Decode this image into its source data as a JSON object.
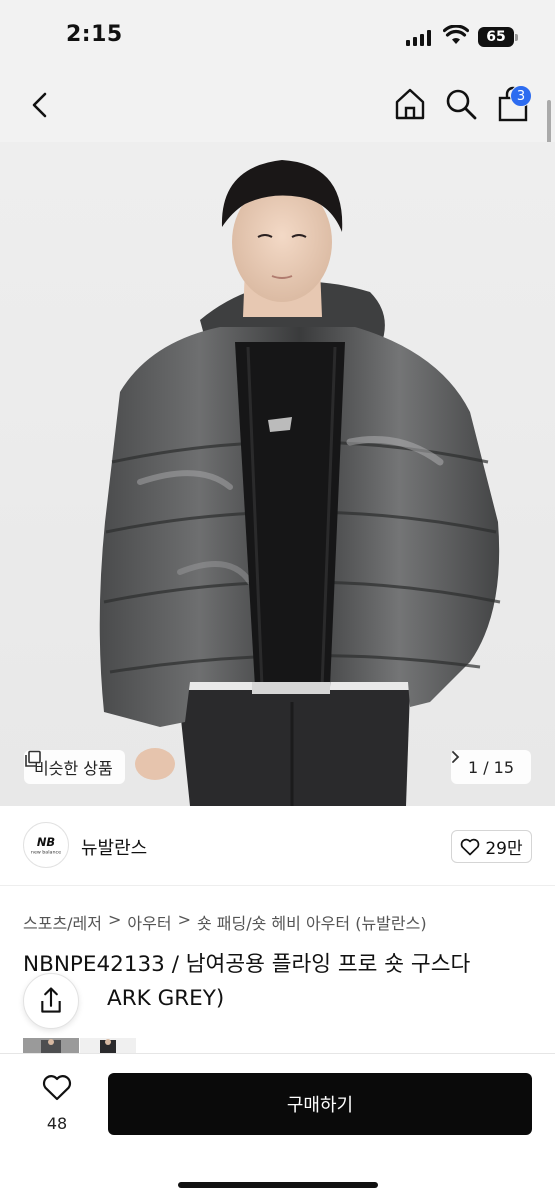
{
  "status_bar": {
    "time": "2:15",
    "battery": "65"
  },
  "nav": {
    "back_icon": "chevron-left-icon",
    "home_icon": "home-icon",
    "search_icon": "search-icon",
    "cart_icon": "shopping-bag-icon",
    "cart_badge": "3",
    "badge_color": "#2d6cf0"
  },
  "hero": {
    "similar_label": "비슷한 상품",
    "pager": "1 / 15"
  },
  "brand": {
    "name": "뉴발란스",
    "likes": "29만"
  },
  "breadcrumb": [
    "스포츠/레저",
    "아우터",
    "숏 패딩/숏 헤비 아우터 (뉴발란스)"
  ],
  "product": {
    "title_line1": "NBNPE42133 / 남여공용 플라잉 프로 숏 구스다",
    "title_line2": "ARK GREY)"
  },
  "bottom_bar": {
    "wish_count": "48",
    "buy_label": "구매하기",
    "buy_color": "#0a0a0a"
  }
}
